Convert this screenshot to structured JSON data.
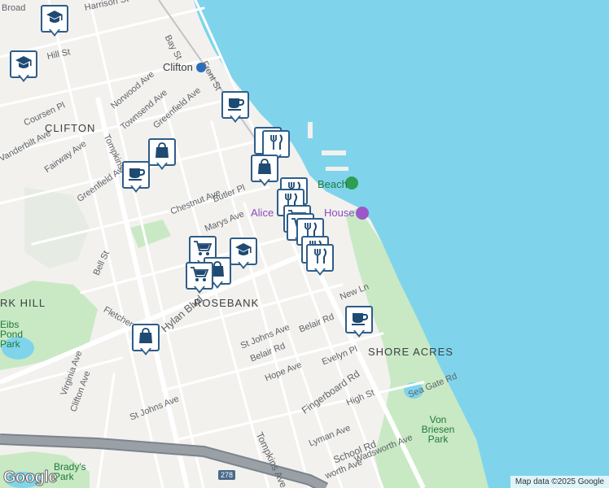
{
  "colors": {
    "water": "#7fd4ec",
    "land": "#f2f1ee",
    "park": "#c8e9c4",
    "road": "#ffffff",
    "highway": "#9aa0a6",
    "marker_border": "#2e5d89",
    "marker_icon": "#1f4a72"
  },
  "map": {
    "streets": {
      "broad": "Broad",
      "harrison": "Harrison St",
      "hill": "Hill St",
      "bay": "Bay St",
      "front": "Front St",
      "norwood": "Norwood Ave",
      "townsend": "Townsend Ave",
      "coursen": "Coursen Pl",
      "tompkins": "Tompkins",
      "greenfield1": "Greenfield Ave",
      "vanderbilt": "Vanderbilt Ave",
      "fairway": "Fairway Ave",
      "greenfield2": "Greenfield Ave",
      "chestnut": "Chestnut Ave",
      "butler": "Butler Pl",
      "marys": "Marys Ave",
      "bell": "Bell St",
      "fletcher": "Fletcher St",
      "hylan": "Hylan Blvd",
      "new": "New Ln",
      "st_johns1": "St Johns Ave",
      "belair1": "Belair Rd",
      "belair2": "Belair Rd",
      "evelyn": "Evelyn Pl",
      "hope": "Hope Ave",
      "fingerboard": "Fingerboard Rd",
      "virginia": "Virginia Ave",
      "clifton": "Clifton Ave",
      "st_johns2": "St Johns Ave",
      "tompkins2": "Tompkins Ave.",
      "high": "High St",
      "sea_gate": "Sea Gate Rd",
      "lyman": "Lyman Ave",
      "school": "School Rd",
      "wadsworth": "Wadsworth Ave",
      "worth": "worth Ave",
      "i278": "278"
    },
    "places": {
      "clifton_station": "Clifton",
      "clifton_area": "CLIFTON",
      "rosebank": "ROSEBANK",
      "shore_acres": "SHORE ACRES",
      "park_hill": "RK HILL",
      "beach": "Beach",
      "alice": "Alice",
      "house": "House",
      "von_briesen": "Von Briesen Park",
      "eibs_pond": "Eibs Pond Park",
      "bradys": "Brady's Park"
    },
    "markers": [
      {
        "type": "school-icon"
      },
      {
        "type": "school-icon"
      },
      {
        "type": "cafe-icon"
      },
      {
        "type": "restaurant-icon"
      },
      {
        "type": "restaurant-icon"
      },
      {
        "type": "shopping-bag-icon"
      },
      {
        "type": "shopping-bag-icon"
      },
      {
        "type": "cafe-icon"
      },
      {
        "type": "restaurant-icon"
      },
      {
        "type": "restaurant-icon"
      },
      {
        "type": "grocery-cart-icon"
      },
      {
        "type": "grocery-cart-icon"
      },
      {
        "type": "restaurant-icon"
      },
      {
        "type": "restaurant-icon"
      },
      {
        "type": "restaurant-icon"
      },
      {
        "type": "grocery-cart-icon"
      },
      {
        "type": "school-icon"
      },
      {
        "type": "shopping-bag-icon"
      },
      {
        "type": "grocery-cart-icon"
      },
      {
        "type": "cafe-icon"
      },
      {
        "type": "shopping-bag-icon"
      }
    ]
  },
  "footer": {
    "logo": "Google",
    "attribution": "Map data ©2025 Google"
  }
}
